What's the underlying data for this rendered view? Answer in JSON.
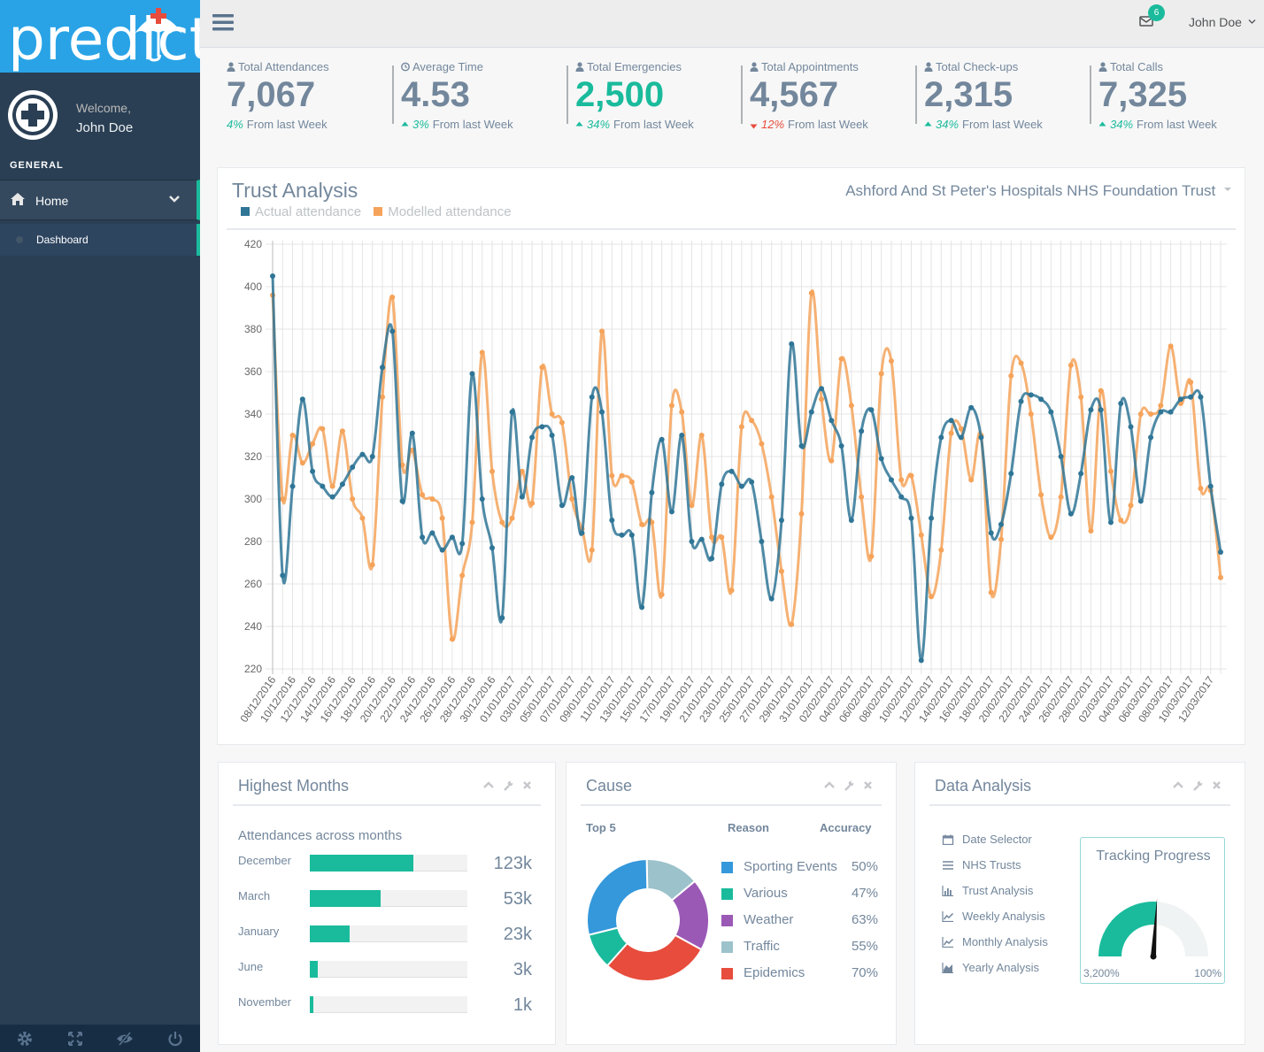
{
  "app": {
    "logo_text": "predict"
  },
  "topbar": {
    "mail_count": "6",
    "user_name": "John Doe"
  },
  "sidebar": {
    "welcome": "Welcome,",
    "user_name": "John Doe",
    "section": "GENERAL",
    "items": [
      {
        "label": "Home"
      },
      {
        "label": "Dashboard"
      }
    ]
  },
  "tiles": [
    {
      "title": "Total Attendances",
      "icon": "user-icon",
      "count": "7,067",
      "change": "4%",
      "suffix": "From last Week",
      "trend": "none"
    },
    {
      "title": "Average Time",
      "icon": "clock-icon",
      "count": "4.53",
      "change": "3%",
      "suffix": "From last Week",
      "trend": "up"
    },
    {
      "title": "Total Emergencies",
      "icon": "user-icon",
      "count": "2,500",
      "change": "34%",
      "suffix": "From last Week",
      "trend": "up"
    },
    {
      "title": "Total Appointments",
      "icon": "user-icon",
      "count": "4,567",
      "change": "12%",
      "suffix": "From last Week",
      "trend": "down"
    },
    {
      "title": "Total Check-ups",
      "icon": "user-icon",
      "count": "2,315",
      "change": "34%",
      "suffix": "From last Week",
      "trend": "up"
    },
    {
      "title": "Total Calls",
      "icon": "user-icon",
      "count": "7,325",
      "change": "34%",
      "suffix": "From last Week",
      "trend": "up"
    }
  ],
  "trust_panel": {
    "title": "Trust Analysis",
    "selected_trust": "Ashford And St Peter's Hospitals NHS Foundation Trust",
    "legend": [
      "Actual attendance",
      "Modelled attendance"
    ]
  },
  "chart_data": {
    "type": "line",
    "ylim": [
      220,
      420
    ],
    "yticks": [
      420,
      400,
      380,
      360,
      340,
      320,
      300,
      280,
      260,
      240,
      220
    ],
    "grid": true,
    "legend_position": "top-left",
    "x_labels": [
      "08/12/2016",
      "10/12/2016",
      "12/12/2016",
      "14/12/2016",
      "16/12/2016",
      "18/12/2016",
      "20/12/2016",
      "22/12/2016",
      "24/12/2016",
      "26/12/2016",
      "28/12/2016",
      "30/12/2016",
      "01/01/2017",
      "03/01/2017",
      "05/01/2017",
      "07/01/2017",
      "09/01/2017",
      "11/01/2017",
      "13/01/2017",
      "15/01/2017",
      "17/01/2017",
      "19/01/2017",
      "21/01/2017",
      "23/01/2017",
      "25/01/2017",
      "27/01/2017",
      "29/01/2017",
      "31/01/2017",
      "02/02/2017",
      "04/02/2017",
      "06/02/2017",
      "08/02/2017",
      "10/02/2017",
      "12/02/2017",
      "14/02/2017",
      "16/02/2017",
      "18/02/2017",
      "20/02/2017",
      "22/02/2017",
      "24/02/2017",
      "26/02/2017",
      "28/02/2017",
      "02/03/2017",
      "04/03/2017",
      "06/03/2017",
      "08/03/2017",
      "10/03/2017",
      "12/03/2017"
    ],
    "series": [
      {
        "name": "Actual attendance",
        "color": "#2F7596",
        "values": [
          405,
          264,
          306,
          347,
          313,
          306,
          301,
          307,
          315,
          321,
          320,
          362,
          379,
          299,
          331,
          282,
          284,
          276,
          282,
          279,
          359,
          300,
          277,
          244,
          341,
          301,
          329,
          334,
          330,
          297,
          310,
          284,
          348,
          341,
          290,
          283,
          283,
          249,
          303,
          328,
          294,
          330,
          280,
          281,
          272,
          307,
          313,
          306,
          308,
          280,
          253,
          290,
          373,
          325,
          341,
          352,
          337,
          325,
          290,
          332,
          342,
          319,
          309,
          301,
          291,
          224,
          291,
          329,
          337,
          329,
          343,
          329,
          284,
          288,
          312,
          346,
          349,
          347,
          341,
          320,
          293,
          312,
          342,
          342,
          289,
          345,
          334,
          299,
          329,
          341,
          341,
          347,
          348,
          348,
          306,
          275
        ]
      },
      {
        "name": "Modelled attendance",
        "color": "#F5A35A",
        "values": [
          396,
          300,
          330,
          317,
          326,
          333,
          306,
          332,
          300,
          291,
          269,
          348,
          395,
          316,
          323,
          302,
          300,
          291,
          234,
          264,
          289,
          369,
          313,
          289,
          291,
          313,
          298,
          362,
          340,
          336,
          300,
          286,
          276,
          379,
          311,
          311,
          308,
          288,
          289,
          255,
          344,
          341,
          297,
          330,
          282,
          282,
          257,
          334,
          337,
          326,
          301,
          266,
          241,
          293,
          397,
          347,
          318,
          366,
          344,
          301,
          273,
          359,
          365,
          309,
          311,
          283,
          254,
          276,
          331,
          333,
          309,
          330,
          256,
          281,
          358,
          364,
          340,
          302,
          282,
          301,
          363,
          348,
          285,
          351,
          313,
          290,
          297,
          340,
          340,
          344,
          372,
          345,
          355,
          305,
          304,
          263
        ]
      }
    ]
  },
  "highest_months": {
    "title": "Highest Months",
    "subtitle": "Attendances across months",
    "rows": [
      {
        "month": "December",
        "value": "123k",
        "fraction": 0.66
      },
      {
        "month": "March",
        "value": "53k",
        "fraction": 0.45
      },
      {
        "month": "January",
        "value": "23k",
        "fraction": 0.25
      },
      {
        "month": "June",
        "value": "3k",
        "fraction": 0.05
      },
      {
        "month": "November",
        "value": "1k",
        "fraction": 0.02
      }
    ]
  },
  "cause": {
    "title": "Cause",
    "headers": [
      "Top 5",
      "Reason",
      "Accuracy"
    ],
    "rows": [
      {
        "name": "Sporting Events",
        "pct": "50%",
        "color": "#3498DB",
        "share": 30
      },
      {
        "name": "Various",
        "pct": "47%",
        "color": "#1ABB9C",
        "share": 10
      },
      {
        "name": "Weather",
        "pct": "63%",
        "color": "#9B59B6",
        "share": 20
      },
      {
        "name": "Traffic",
        "pct": "55%",
        "color": "#9CC2CB",
        "share": 15
      },
      {
        "name": "Epidemics",
        "pct": "70%",
        "color": "#E74C3C",
        "share": 30
      }
    ]
  },
  "data_analysis": {
    "title": "Data Analysis",
    "items": [
      {
        "label": "Date Selector",
        "icon": "calendar-icon"
      },
      {
        "label": "NHS Trusts",
        "icon": "list-icon"
      },
      {
        "label": "Trust Analysis",
        "icon": "bar-chart-icon"
      },
      {
        "label": "Weekly Analysis",
        "icon": "line-chart-icon"
      },
      {
        "label": "Monthly Analysis",
        "icon": "line-chart-icon"
      },
      {
        "label": "Yearly Analysis",
        "icon": "area-chart-icon"
      }
    ],
    "gauge": {
      "title": "Tracking Progress",
      "min_label": "3,200%",
      "max_label": "100%",
      "level": 0.52
    }
  }
}
